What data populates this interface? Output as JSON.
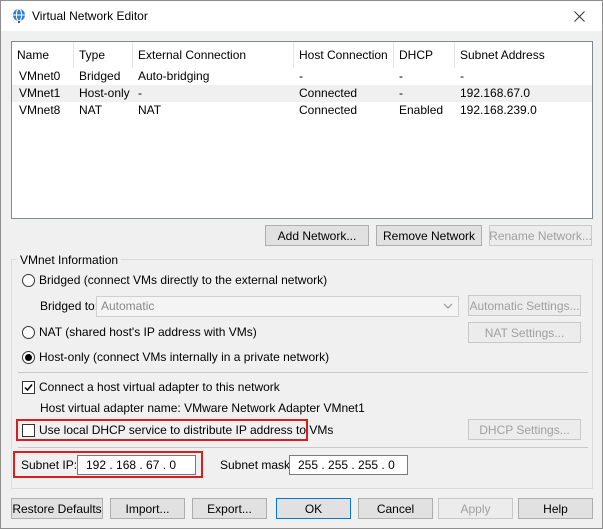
{
  "window": {
    "title": "Virtual Network Editor",
    "icon": "globe-network-icon"
  },
  "table": {
    "headers": [
      "Name",
      "Type",
      "External Connection",
      "Host Connection",
      "DHCP",
      "Subnet Address"
    ],
    "rows": [
      {
        "name": "VMnet0",
        "type": "Bridged",
        "external": "Auto-bridging",
        "host": "-",
        "dhcp": "-",
        "subnet": "-"
      },
      {
        "name": "VMnet1",
        "type": "Host-only",
        "external": "-",
        "host": "Connected",
        "dhcp": "-",
        "subnet": "192.168.67.0"
      },
      {
        "name": "VMnet8",
        "type": "NAT",
        "external": "NAT",
        "host": "Connected",
        "dhcp": "Enabled",
        "subnet": "192.168.239.0"
      }
    ]
  },
  "network_buttons": {
    "add": "Add Network...",
    "remove": "Remove Network",
    "rename": "Rename Network..."
  },
  "info": {
    "group_title": "VMnet Information",
    "bridged_label": "Bridged (connect VMs directly to the external network)",
    "bridged_to_label": "Bridged to:",
    "bridged_to_value": "Automatic",
    "auto_settings": "Automatic Settings...",
    "nat_label": "NAT (shared host's IP address with VMs)",
    "nat_settings": "NAT Settings...",
    "hostonly_label": "Host-only (connect VMs internally in a private network)",
    "connect_adapter_label": "Connect a host virtual adapter to this network",
    "adapter_name_label": "Host virtual adapter name: VMware Network Adapter VMnet1",
    "dhcp_label": "Use local DHCP service to distribute IP address to VMs",
    "dhcp_settings": "DHCP Settings...",
    "subnet_ip_label": "Subnet IP:",
    "subnet_ip_value": "192 . 168 . 67 . 0",
    "subnet_mask_label": "Subnet mask:",
    "subnet_mask_value": "255 . 255 . 255 . 0"
  },
  "footer": {
    "restore": "Restore Defaults",
    "import": "Import...",
    "export": "Export...",
    "ok": "OK",
    "cancel": "Cancel",
    "apply": "Apply",
    "help": "Help"
  },
  "colors": {
    "highlight_border": "#d81e1e",
    "focus_border": "#0078d7"
  }
}
